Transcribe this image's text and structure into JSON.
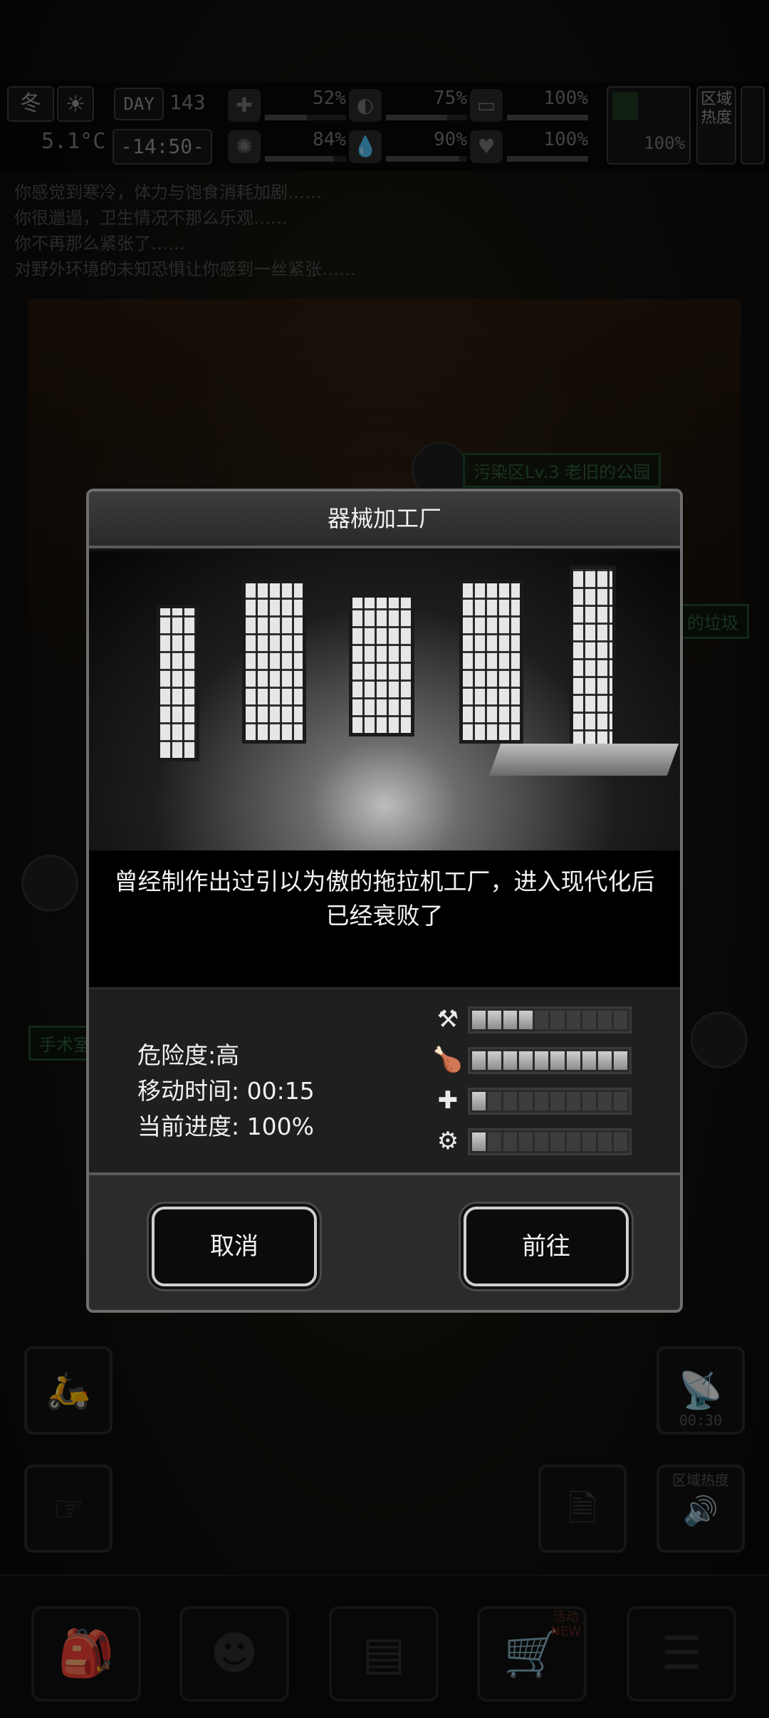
{
  "hud": {
    "season": "冬",
    "day_label": "DAY",
    "day_number": "143",
    "temperature": "5.1°C",
    "clock": "-14:50-",
    "stats": [
      {
        "icon": "medkit-icon",
        "glyph": "✚",
        "value": "52%",
        "level": 0.52
      },
      {
        "icon": "stomach-icon",
        "glyph": "◐",
        "value": "75%",
        "level": 0.75
      },
      {
        "icon": "pill-icon",
        "glyph": "▭",
        "value": "100%",
        "level": 1.0
      },
      {
        "icon": "brain-icon",
        "glyph": "✺",
        "value": "84%",
        "level": 0.84
      },
      {
        "icon": "water-drop-icon",
        "glyph": "💧",
        "value": "90%",
        "level": 0.9
      },
      {
        "icon": "heart-icon",
        "glyph": "♥",
        "value": "100%",
        "level": 1.0
      }
    ],
    "stamina_value": "100%",
    "zone_heat_label": "区域热度"
  },
  "log": [
    "你感觉到寒冷，体力与饱食消耗加剧……",
    "你很邋遢，卫生情况不那么乐观……",
    "你不再那么紧张了……",
    "对野外环境的未知恐惧让你感到一丝紧张……"
  ],
  "map": {
    "marker_park": "污染区Lv.3 老旧的公园",
    "marker_right": "的垃圾",
    "marker_left": "手术室"
  },
  "side": {
    "radar_timer": "00:30",
    "zone_heat_label": "区域热度",
    "event_badge": "活动",
    "event_new": "NEW"
  },
  "dialog": {
    "title": "器械加工厂",
    "description": "曾经制作出过引以为傲的拖拉机工厂，进入现代化后已经衰败了",
    "danger_label": "危险度:",
    "danger_value": "高",
    "travel_label": "移动时间:",
    "travel_value": "00:15",
    "progress_label": "当前进度:",
    "progress_value": "100%",
    "resources": [
      {
        "icon": "weapon-icon",
        "glyph": "⚒",
        "filled": 4,
        "total": 10
      },
      {
        "icon": "food-meat-icon",
        "glyph": "🍗",
        "filled": 10,
        "total": 10
      },
      {
        "icon": "medical-kit-icon",
        "glyph": "✚",
        "filled": 1,
        "total": 10
      },
      {
        "icon": "parts-gear-icon",
        "glyph": "⚙",
        "filled": 1,
        "total": 10
      }
    ],
    "cancel_label": "取消",
    "go_label": "前往"
  },
  "colors": {
    "dialog_border": "#6e6e6e",
    "button_border": "#cfcfcf",
    "bar_fill": "#bdbdbd"
  }
}
